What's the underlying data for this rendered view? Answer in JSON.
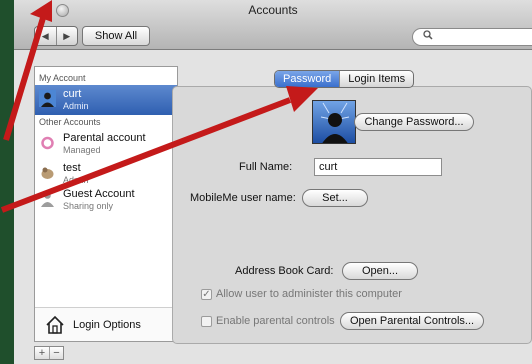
{
  "window": {
    "title": "Accounts"
  },
  "toolbar": {
    "back": "◀",
    "forward": "▶",
    "show_all": "Show All",
    "search_glyph": "🔍"
  },
  "sidebar": {
    "header_my": "My Account",
    "header_other": "Other Accounts",
    "items": [
      {
        "name": "curt",
        "role": "Admin",
        "selected": true
      },
      {
        "name": "Parental account",
        "role": "Managed"
      },
      {
        "name": "test",
        "role": "Admin"
      },
      {
        "name": "Guest Account",
        "role": "Sharing only"
      }
    ],
    "login_options": "Login Options",
    "add": "+",
    "remove": "−"
  },
  "tabs": [
    {
      "label": "Password",
      "active": true
    },
    {
      "label": "Login Items"
    }
  ],
  "panel": {
    "change_password": "Change Password...",
    "full_name_label": "Full Name:",
    "full_name_value": "curt",
    "mobileme_label": "MobileMe user name:",
    "set_button": "Set...",
    "address_book_label": "Address Book Card:",
    "open_button": "Open...",
    "allow_admin_label": "Allow user to administer this computer",
    "allow_admin_checked": true,
    "parental_label": "Enable parental controls",
    "parental_checked": false,
    "open_parental_button": "Open Parental Controls..."
  },
  "colors": {
    "arrow": "#c41a1a",
    "selection": "#3a67b8",
    "background": "#1f4f2c"
  }
}
